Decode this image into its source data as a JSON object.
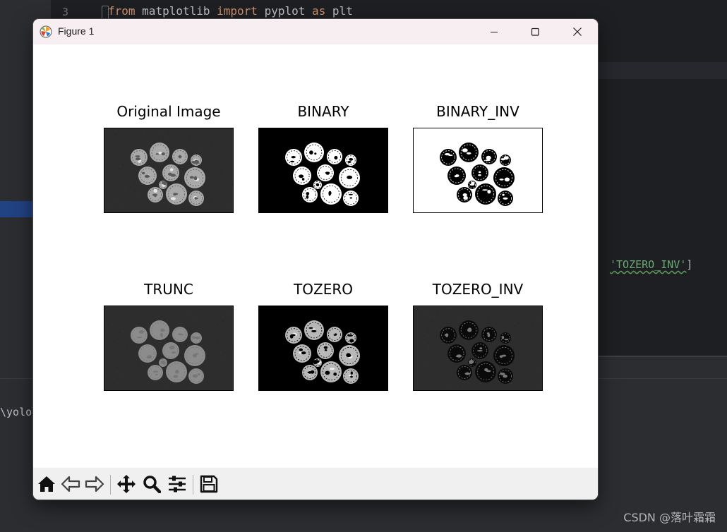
{
  "editor": {
    "line_number": "3",
    "code": {
      "kw1": "from",
      "module": "matplotlib",
      "kw2": "import",
      "name": "pyplot",
      "kw3": "as",
      "alias": "plt"
    },
    "snippet": {
      "string": "'TOZERO_INV'",
      "bracket": "]"
    }
  },
  "terminal": {
    "text": "\\yolo"
  },
  "watermark": "CSDN @落叶霜霜",
  "window": {
    "title": "Figure 1",
    "controls": {
      "minimize": "minimize-icon",
      "maximize": "maximize-icon",
      "close": "close-icon"
    }
  },
  "figure": {
    "subplots": [
      {
        "title": "Original Image"
      },
      {
        "title": "BINARY"
      },
      {
        "title": "BINARY_INV"
      },
      {
        "title": "TRUNC"
      },
      {
        "title": "TOZERO"
      },
      {
        "title": "TOZERO_INV"
      }
    ]
  },
  "toolbar": {
    "buttons": [
      "home-icon",
      "back-icon",
      "forward-icon",
      "pan-icon",
      "zoom-icon",
      "configure-subplots-icon",
      "save-icon"
    ]
  },
  "colors": {
    "titlebar": "#f7eef2",
    "toolbar": "#f0f0f0",
    "ide_bg": "#1e1f22",
    "keyword": "#cf8e6d",
    "string": "#6aab73"
  }
}
